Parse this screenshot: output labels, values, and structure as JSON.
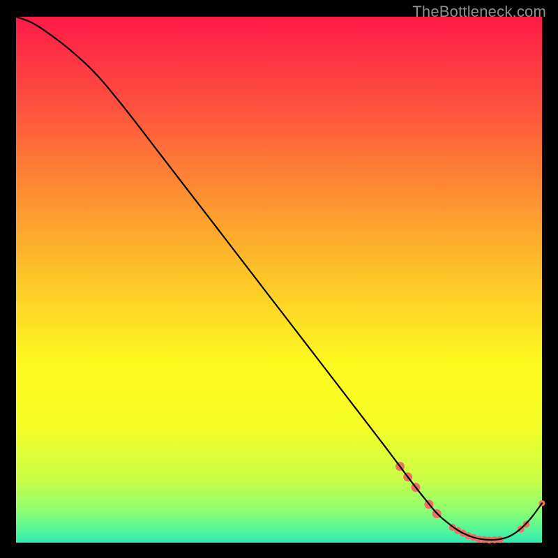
{
  "watermark": "TheBottleneck.com",
  "chart_data": {
    "type": "line",
    "title": "",
    "xlabel": "",
    "ylabel": "",
    "xlim": [
      0,
      100
    ],
    "ylim": [
      0,
      100
    ],
    "grid": false,
    "series": [
      {
        "name": "curve",
        "color": "#000000",
        "x": [
          0,
          3,
          6,
          10,
          15,
          20,
          25,
          30,
          35,
          40,
          45,
          50,
          55,
          60,
          65,
          70,
          73,
          76,
          78,
          80,
          82,
          84,
          86,
          88,
          90,
          92,
          94,
          96,
          98,
          100
        ],
        "y": [
          100,
          99,
          97,
          94,
          89.5,
          83.5,
          77,
          70.5,
          64,
          57.5,
          51,
          44.5,
          38,
          31.5,
          25,
          18.5,
          14.5,
          10.5,
          8,
          5.5,
          3.8,
          2.3,
          1.3,
          0.7,
          0.5,
          0.6,
          1.2,
          2.6,
          4.7,
          7.5
        ]
      }
    ],
    "markers": [
      {
        "x": 73.0,
        "y": 14.5,
        "r": 6.5,
        "color": "#ec7063"
      },
      {
        "x": 74.5,
        "y": 12.5,
        "r": 6.5,
        "color": "#ec7063"
      },
      {
        "x": 76.0,
        "y": 10.5,
        "r": 6.5,
        "color": "#ec7063"
      },
      {
        "x": 78.5,
        "y": 7.3,
        "r": 6.5,
        "color": "#ec7063"
      },
      {
        "x": 80.0,
        "y": 5.5,
        "r": 6.5,
        "color": "#ec7063"
      },
      {
        "x": 83.0,
        "y": 2.9,
        "r": 5.0,
        "color": "#ec7063"
      },
      {
        "x": 84.0,
        "y": 2.3,
        "r": 5.0,
        "color": "#ec7063"
      },
      {
        "x": 85.0,
        "y": 1.8,
        "r": 5.0,
        "color": "#ec7063"
      },
      {
        "x": 86.0,
        "y": 1.3,
        "r": 5.0,
        "color": "#ec7063"
      },
      {
        "x": 87.0,
        "y": 1.0,
        "r": 5.0,
        "color": "#ec7063"
      },
      {
        "x": 88.0,
        "y": 0.7,
        "r": 5.0,
        "color": "#ec7063"
      },
      {
        "x": 89.0,
        "y": 0.6,
        "r": 5.0,
        "color": "#ec7063"
      },
      {
        "x": 90.0,
        "y": 0.5,
        "r": 5.0,
        "color": "#ec7063"
      },
      {
        "x": 91.0,
        "y": 0.55,
        "r": 5.0,
        "color": "#ec7063"
      },
      {
        "x": 92.0,
        "y": 0.6,
        "r": 5.0,
        "color": "#ec7063"
      },
      {
        "x": 96.0,
        "y": 2.6,
        "r": 5.0,
        "color": "#ec7063"
      },
      {
        "x": 97.0,
        "y": 3.5,
        "r": 5.0,
        "color": "#ec7063"
      },
      {
        "x": 100.0,
        "y": 7.5,
        "r": 4.5,
        "color": "#ec7063"
      }
    ],
    "background_gradient": {
      "stops": [
        {
          "y": 100,
          "color": "#fe1a48"
        },
        {
          "y": 82,
          "color": "#fe553e"
        },
        {
          "y": 66,
          "color": "#fd9032"
        },
        {
          "y": 50,
          "color": "#fdc728"
        },
        {
          "y": 34,
          "color": "#fdfa20"
        },
        {
          "y": 22,
          "color": "#f4fd26"
        },
        {
          "y": 12,
          "color": "#c9fe47"
        },
        {
          "y": 6,
          "color": "#8dfe72"
        },
        {
          "y": 2,
          "color": "#4cf59e"
        },
        {
          "y": 0,
          "color": "#32e7b1"
        }
      ]
    }
  }
}
